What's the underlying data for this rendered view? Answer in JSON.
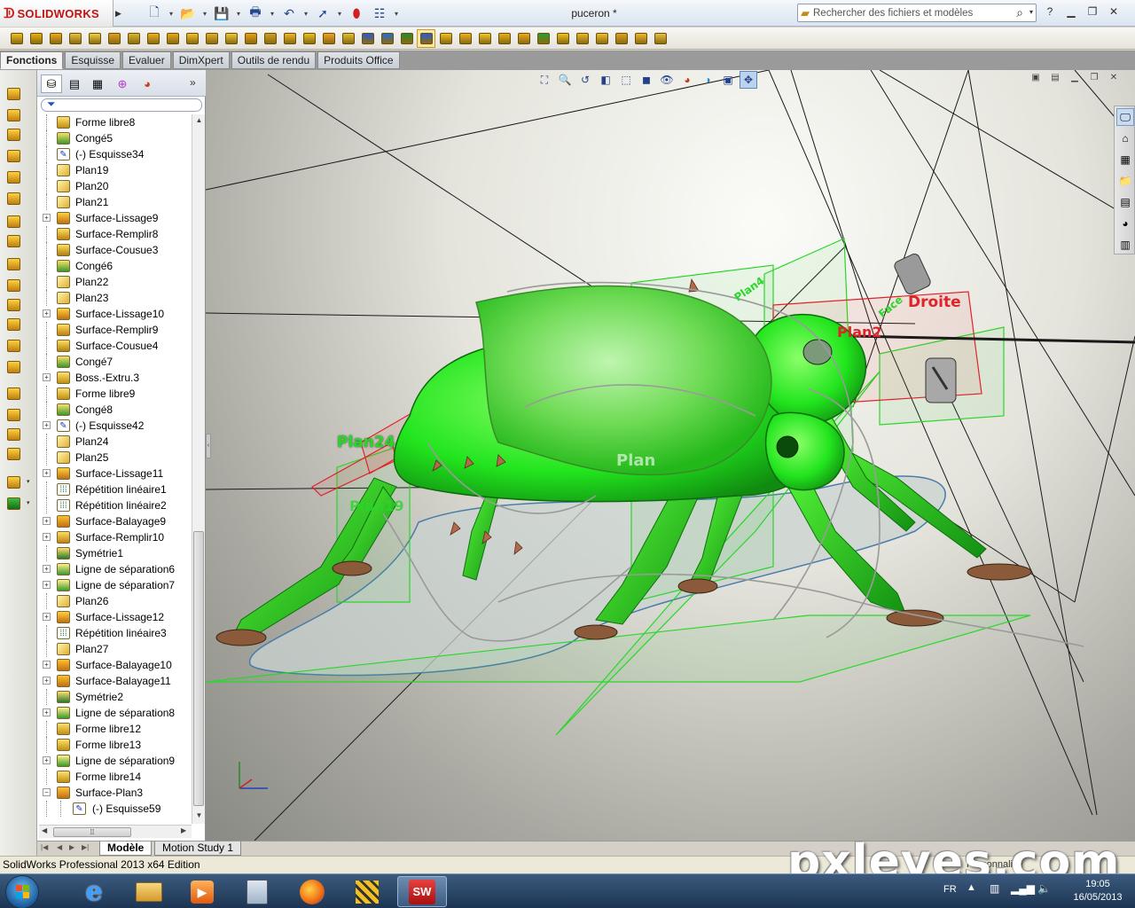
{
  "app": {
    "brand": "SOLIDWORKS",
    "document_title": "puceron *",
    "search_placeholder": "Rechercher des fichiers et modèles",
    "status_text": "SolidWorks Professional 2013 x64 Edition",
    "status_right": "Personnalisé",
    "watermark": "pxleyes.com"
  },
  "command_tabs": [
    "Fonctions",
    "Esquisse",
    "Evaluer",
    "DimXpert",
    "Outils de rendu",
    "Produits Office"
  ],
  "feature_tree": [
    {
      "label": "Forme libre8",
      "icon": "freeform-icon",
      "expand": false
    },
    {
      "label": "Congé5",
      "icon": "fillet-icon",
      "expand": false
    },
    {
      "label": "(-) Esquisse34",
      "icon": "sketch-icon",
      "expand": false
    },
    {
      "label": "Plan19",
      "icon": "plane-icon",
      "expand": false
    },
    {
      "label": "Plan20",
      "icon": "plane-icon",
      "expand": false
    },
    {
      "label": "Plan21",
      "icon": "plane-icon",
      "expand": false
    },
    {
      "label": "Surface-Lissage9",
      "icon": "loft-icon",
      "expand": true
    },
    {
      "label": "Surface-Remplir8",
      "icon": "fill-icon",
      "expand": false
    },
    {
      "label": "Surface-Cousue3",
      "icon": "knit-icon",
      "expand": false
    },
    {
      "label": "Congé6",
      "icon": "fillet-icon",
      "expand": false
    },
    {
      "label": "Plan22",
      "icon": "plane-icon",
      "expand": false
    },
    {
      "label": "Plan23",
      "icon": "plane-icon",
      "expand": false
    },
    {
      "label": "Surface-Lissage10",
      "icon": "loft-icon",
      "expand": true
    },
    {
      "label": "Surface-Remplir9",
      "icon": "fill-icon",
      "expand": false
    },
    {
      "label": "Surface-Cousue4",
      "icon": "knit-icon",
      "expand": false
    },
    {
      "label": "Congé7",
      "icon": "fillet-icon",
      "expand": false
    },
    {
      "label": "Boss.-Extru.3",
      "icon": "extrude-icon",
      "expand": true
    },
    {
      "label": "Forme libre9",
      "icon": "freeform-icon",
      "expand": false
    },
    {
      "label": "Congé8",
      "icon": "fillet-icon",
      "expand": false
    },
    {
      "label": "(-) Esquisse42",
      "icon": "sketch-icon",
      "expand": true
    },
    {
      "label": "Plan24",
      "icon": "plane-icon",
      "expand": false
    },
    {
      "label": "Plan25",
      "icon": "plane-icon",
      "expand": false
    },
    {
      "label": "Surface-Lissage11",
      "icon": "loft-icon",
      "expand": true
    },
    {
      "label": "Répétition linéaire1",
      "icon": "pattern-icon",
      "expand": false
    },
    {
      "label": "Répétition linéaire2",
      "icon": "pattern-icon",
      "expand": false
    },
    {
      "label": "Surface-Balayage9",
      "icon": "sweep-icon",
      "expand": true
    },
    {
      "label": "Surface-Remplir10",
      "icon": "fill-icon",
      "expand": true
    },
    {
      "label": "Symétrie1",
      "icon": "mirror-icon",
      "expand": false
    },
    {
      "label": "Ligne de séparation6",
      "icon": "split-line-icon",
      "expand": true
    },
    {
      "label": "Ligne de séparation7",
      "icon": "split-line-icon",
      "expand": true
    },
    {
      "label": "Plan26",
      "icon": "plane-icon",
      "expand": false
    },
    {
      "label": "Surface-Lissage12",
      "icon": "loft-icon",
      "expand": true
    },
    {
      "label": "Répétition linéaire3",
      "icon": "pattern-icon",
      "expand": false
    },
    {
      "label": "Plan27",
      "icon": "plane-icon",
      "expand": false
    },
    {
      "label": "Surface-Balayage10",
      "icon": "sweep-icon",
      "expand": true
    },
    {
      "label": "Surface-Balayage11",
      "icon": "sweep-icon",
      "expand": true
    },
    {
      "label": "Symétrie2",
      "icon": "mirror-icon",
      "expand": false
    },
    {
      "label": "Ligne de séparation8",
      "icon": "split-line-icon",
      "expand": true
    },
    {
      "label": "Forme libre12",
      "icon": "freeform-icon",
      "expand": false
    },
    {
      "label": "Forme libre13",
      "icon": "freeform-icon",
      "expand": false
    },
    {
      "label": "Ligne de séparation9",
      "icon": "split-line-icon",
      "expand": true
    },
    {
      "label": "Forme libre14",
      "icon": "freeform-icon",
      "expand": false
    },
    {
      "label": "Surface-Plan3",
      "icon": "planar-surface-icon",
      "expand": true,
      "expanded": true
    },
    {
      "label": "(-) Esquisse59",
      "icon": "sketch-icon",
      "expand": false,
      "child": true
    }
  ],
  "model_tabs": [
    "Modèle",
    "Motion Study 1"
  ],
  "viewport_annotations": {
    "plan24": "Plan24",
    "plan19": "Plan19",
    "plan_center": "Plan",
    "plan4": "Plan4",
    "plan2": "Plan2",
    "droite": "Droite",
    "face": "Face"
  },
  "tray": {
    "lang": "FR",
    "time": "19:05",
    "date": "16/05/2013"
  },
  "colors": {
    "model_green": "#22e51e",
    "plane_green": "#2ad62a",
    "plane_red": "#e0232b",
    "brand_red": "#c21313"
  }
}
